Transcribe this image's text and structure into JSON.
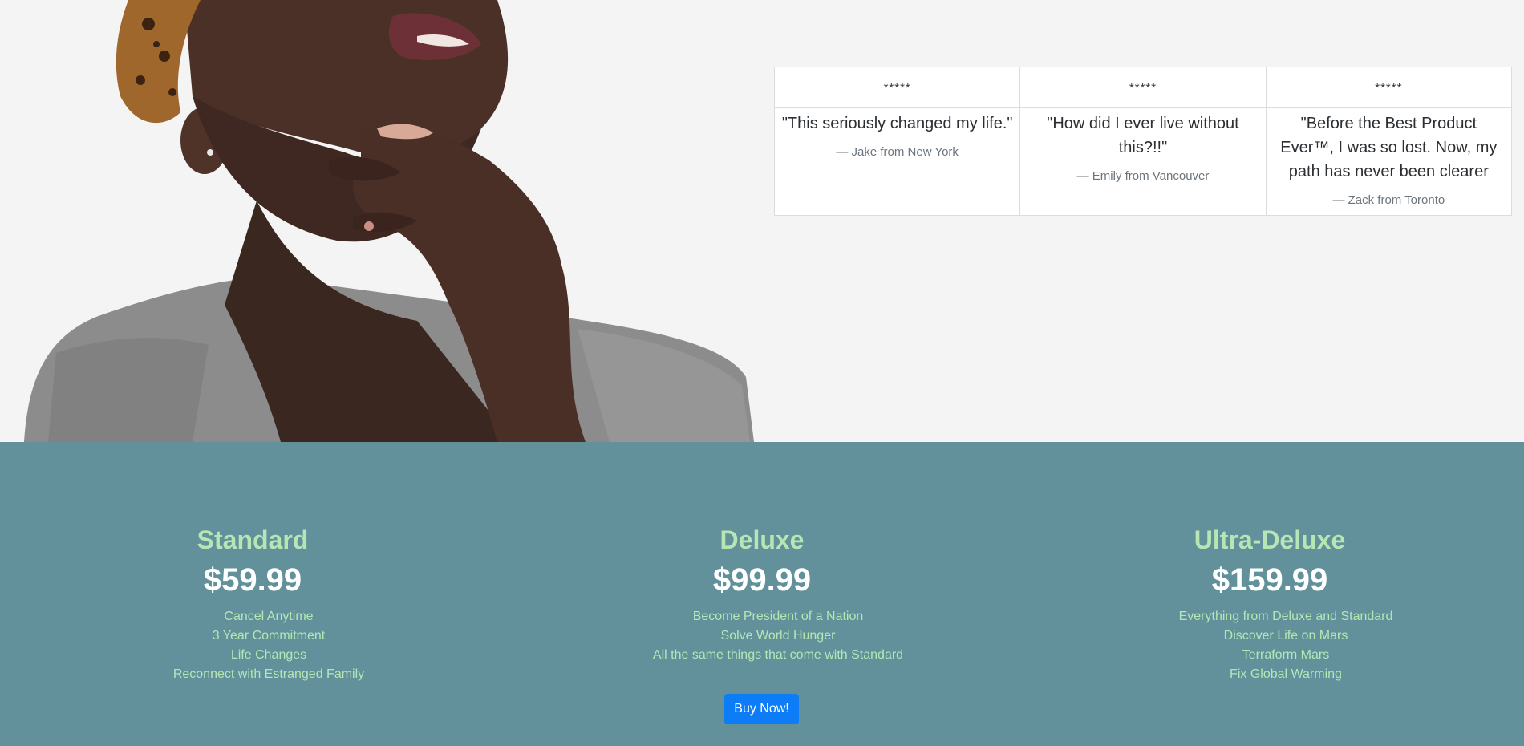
{
  "testimonials": [
    {
      "rating": "*****",
      "quote": "\"This seriously changed my life.\"",
      "author": "— Jake from New York"
    },
    {
      "rating": "*****",
      "quote": "\"How did I ever live without this?!!\"",
      "author": "— Emily from Vancouver"
    },
    {
      "rating": "*****",
      "quote": "\"Before the Best Product Ever™, I was so lost. Now, my path has never been clearer",
      "author": "— Zack from Toronto"
    }
  ],
  "plans": [
    {
      "name": "Standard",
      "price": "$59.99",
      "features": [
        "Cancel Anytime",
        "3 Year Commitment",
        "Life Changes",
        "Reconnect with Estranged Family"
      ]
    },
    {
      "name": "Deluxe",
      "price": "$99.99",
      "features": [
        "Become President of a Nation",
        "Solve World Hunger",
        "All the same things that come with Standard"
      ]
    },
    {
      "name": "Ultra-Deluxe",
      "price": "$159.99",
      "features": [
        "Everything from Deluxe and Standard",
        "Discover Life on Mars",
        "Terraform Mars",
        "Fix Global Warming"
      ]
    }
  ],
  "buy_button": "Buy Now!",
  "colors": {
    "background": "#f4f4f4",
    "pricing_background": "#62919c",
    "plan_name": "#b5e6b4",
    "price": "#ffffff",
    "button": "#0d7cf7"
  }
}
